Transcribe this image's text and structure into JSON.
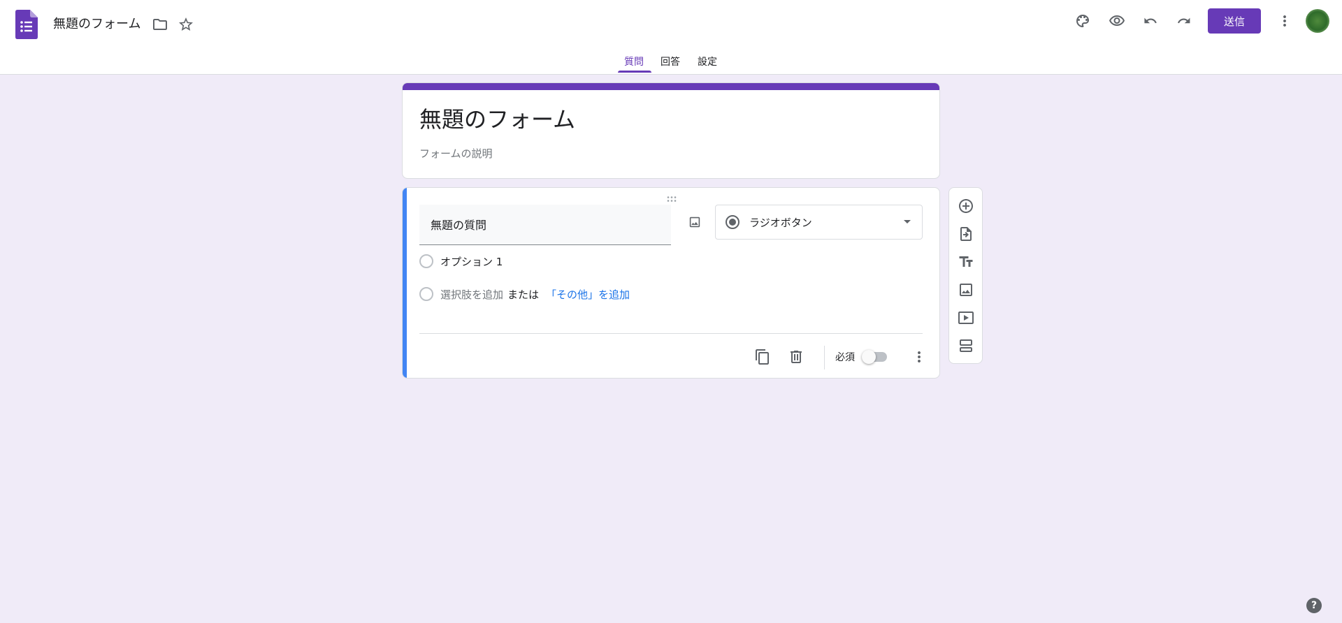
{
  "header": {
    "doc_title": "無題のフォーム",
    "send_label": "送信",
    "icons": [
      "forms-logo-icon",
      "folder-icon",
      "star-icon",
      "palette-icon",
      "preview-eye-icon",
      "undo-icon",
      "redo-icon",
      "more-vert-icon"
    ]
  },
  "tabs": [
    {
      "label": "質問",
      "active": true
    },
    {
      "label": "回答",
      "active": false
    },
    {
      "label": "設定",
      "active": false
    }
  ],
  "form": {
    "title": "無題のフォーム",
    "description_placeholder": "フォームの説明"
  },
  "question": {
    "title": "無題の質問",
    "type": "ラジオボタン",
    "options": [
      "オプション 1"
    ],
    "add_option": "選択肢を追加",
    "or": "または",
    "add_other": "「その他」を追加",
    "required_label": "必須",
    "required": false
  },
  "toolbar": {
    "items": [
      "add-question-icon",
      "import-questions-icon",
      "add-title-icon",
      "add-image-icon",
      "add-video-icon",
      "add-section-icon"
    ]
  },
  "help": "?",
  "colors": {
    "accent": "#673ab7",
    "background": "#f0ebf8",
    "active_card": "#4285f4",
    "link": "#1a73e8"
  }
}
